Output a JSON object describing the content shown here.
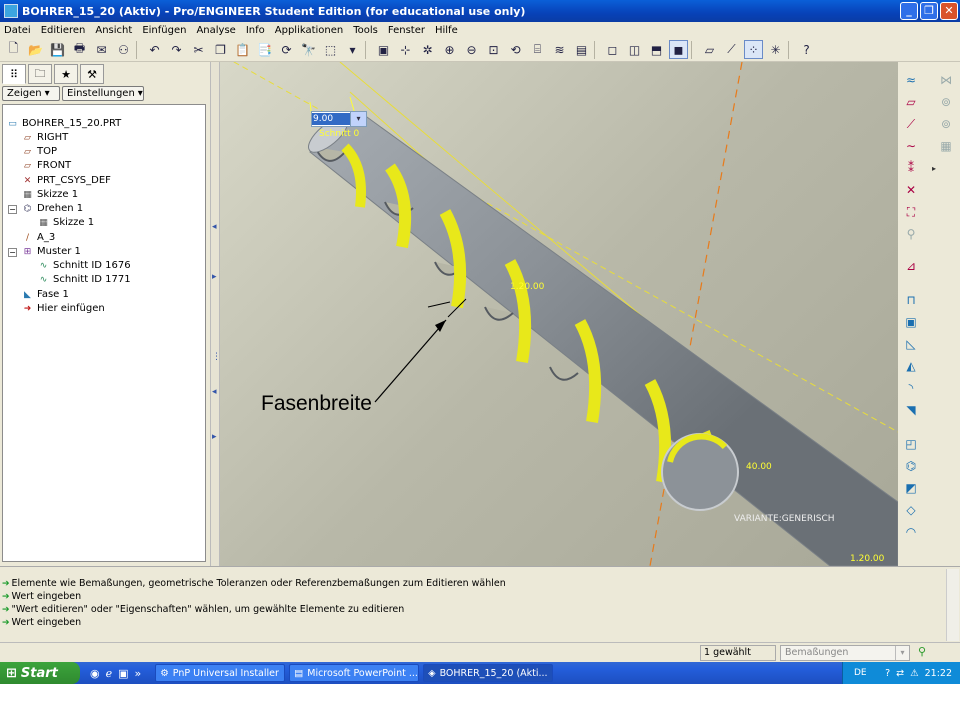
{
  "window": {
    "title": "BOHRER_15_20 (Aktiv) - Pro/ENGINEER Student Edition (for educational use only)",
    "controls": [
      "_",
      "❐",
      "✕"
    ]
  },
  "menu": [
    "Datei",
    "Editieren",
    "Ansicht",
    "Einfügen",
    "Analyse",
    "Info",
    "Applikationen",
    "Tools",
    "Fenster",
    "Hilfe"
  ],
  "panel": {
    "show_button": "Zeigen",
    "settings_button": "Einstellungen",
    "tree": [
      {
        "label": "BOHRER_15_20.PRT",
        "icon": "part-icon"
      },
      {
        "label": "RIGHT",
        "icon": "datum-plane-icon"
      },
      {
        "label": "TOP",
        "icon": "datum-plane-icon"
      },
      {
        "label": "FRONT",
        "icon": "datum-plane-icon"
      },
      {
        "label": "PRT_CSYS_DEF",
        "icon": "csys-icon"
      },
      {
        "label": "Skizze 1",
        "icon": "sketch-icon"
      },
      {
        "label": "Drehen 1",
        "icon": "revolve-icon"
      },
      {
        "label": "Skizze 1",
        "icon": "sketch-icon"
      },
      {
        "label": "A_3",
        "icon": "axis-icon"
      },
      {
        "label": "Muster 1",
        "icon": "pattern-icon"
      },
      {
        "label": "Schnitt ID 1676",
        "icon": "cut-icon"
      },
      {
        "label": "Schnitt ID 1771",
        "icon": "cut-icon"
      },
      {
        "label": "Fase 1",
        "icon": "chamfer-icon"
      },
      {
        "label": "Hier einfügen",
        "icon": "insert-here-icon"
      }
    ]
  },
  "viewport": {
    "dim_input_value": "9.00",
    "dim_labels": {
      "schnitt": "Schnitt 0",
      "d1": "1.20.00",
      "d2": "40.00",
      "d3": "1.20.00",
      "variant": "VARIANTE:GENERISCH"
    },
    "annotation": "Fasenbreite"
  },
  "messages": [
    "Elemente wie Bemaßungen, geometrische Toleranzen oder Referenzbemaßungen zum Editieren wählen",
    "Wert eingeben",
    "\"Wert editieren\" oder \"Eigenschaften\" wählen, um gewählte Elemente zu editieren",
    "Wert eingeben"
  ],
  "status": {
    "selected": "1 gewählt",
    "filter": "Bemaßungen"
  },
  "taskbar": {
    "start": "Start",
    "tasks": [
      "PnP Universal Installer",
      "Microsoft PowerPoint ...",
      "BOHRER_15_20 (Akti..."
    ],
    "language": "DE",
    "clock": "21:22"
  },
  "colors": {
    "titlebar": "#0842b8",
    "chrome": "#ece9d8",
    "drill_body": "#8c9298",
    "flute_highlight": "#e8e81a",
    "datum_axis": "#e87a1a"
  }
}
